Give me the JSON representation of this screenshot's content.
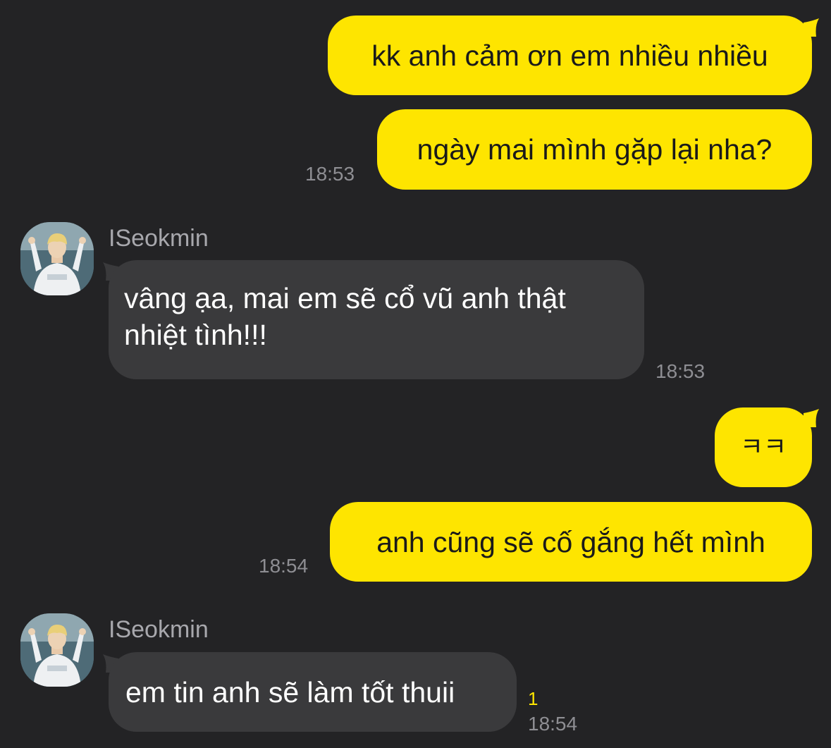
{
  "conversation": {
    "messages": [
      {
        "text": "kk anh cảm ơn em nhiều nhiều"
      },
      {
        "text": "ngày mai mình gặp lại nha?",
        "time": "18:53"
      },
      {
        "sender": "ISeokmin",
        "text_line1": "vâng ạa, mai em sẽ cổ vũ anh thật",
        "text_line2": "nhiệt tình!!!",
        "time": "18:53"
      },
      {
        "text": "ㅋㅋ"
      },
      {
        "text": "anh cũng sẽ cố gắng hết mình",
        "time": "18:54"
      },
      {
        "sender": "ISeokmin",
        "text": "em tin anh sẽ làm tốt thuii",
        "unread": "1",
        "time": "18:54"
      }
    ]
  },
  "colors": {
    "background": "#232325",
    "outgoing_bubble": "#FEE500",
    "incoming_bubble": "#3a3a3c",
    "timestamp": "#8e8e93",
    "unread_count": "#FEE500"
  },
  "icons": {
    "avatar": "profile-photo-avatar"
  }
}
